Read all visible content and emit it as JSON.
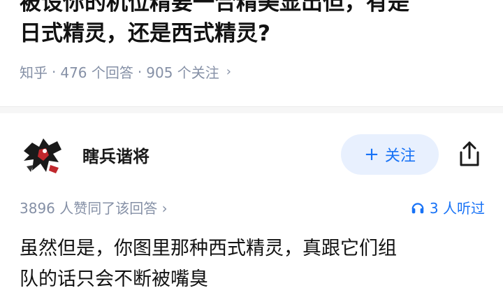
{
  "question": {
    "title_line1_partial": "被设你的机位精要一合精美显出但，有是",
    "title_line2": "日式精灵，还是西式精灵?",
    "source": "知乎",
    "answers_count": "476 个回答",
    "followers_count": "905 个关注",
    "chevron": "›"
  },
  "answer": {
    "author_name": "瞎兵谐将",
    "follow_label": "关注",
    "follow_plus": "+",
    "likes_text": "3896 人赞同了该回答 ›",
    "listen_text": "3 人听过",
    "body_line1": "虽然但是，你图里那种西式精灵，真跟它们组",
    "body_line2_partial": "队的话只会不断被嘴臭"
  },
  "colors": {
    "accent": "#1772f6",
    "follow_bg": "#e8f0fe",
    "meta_gray": "#8590a6"
  },
  "icons": {
    "share": "share-icon",
    "headphones": "headphones-icon",
    "avatar": "ink-figure-avatar"
  }
}
